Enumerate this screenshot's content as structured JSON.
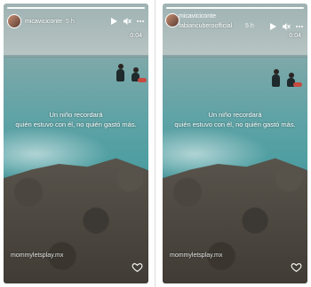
{
  "stories": [
    {
      "username": "micaviciconte",
      "time_ago": "5 h",
      "timer": "0:04",
      "caption_line1": "Un niño recordará",
      "caption_line2": "quién estuvo con él, no quién  gastó más.",
      "watermark": "mommyletsplay.mx"
    },
    {
      "username_top": "micaviciconte",
      "username": "fabiancuberoofficial",
      "time_ago": "5 h",
      "timer": "0:04",
      "caption_line1": "Un niño recordará",
      "caption_line2": "quién estuvo con él, no quién  gastó más.",
      "watermark": "mommyletsplay.mx"
    }
  ],
  "icons": {
    "play": "play-icon",
    "mute": "speaker-muted-icon",
    "more": "more-horizontal-icon",
    "like": "heart-icon"
  },
  "colors": {
    "overlay_text": "#ffffff",
    "heart_stroke": "#ffffff"
  }
}
